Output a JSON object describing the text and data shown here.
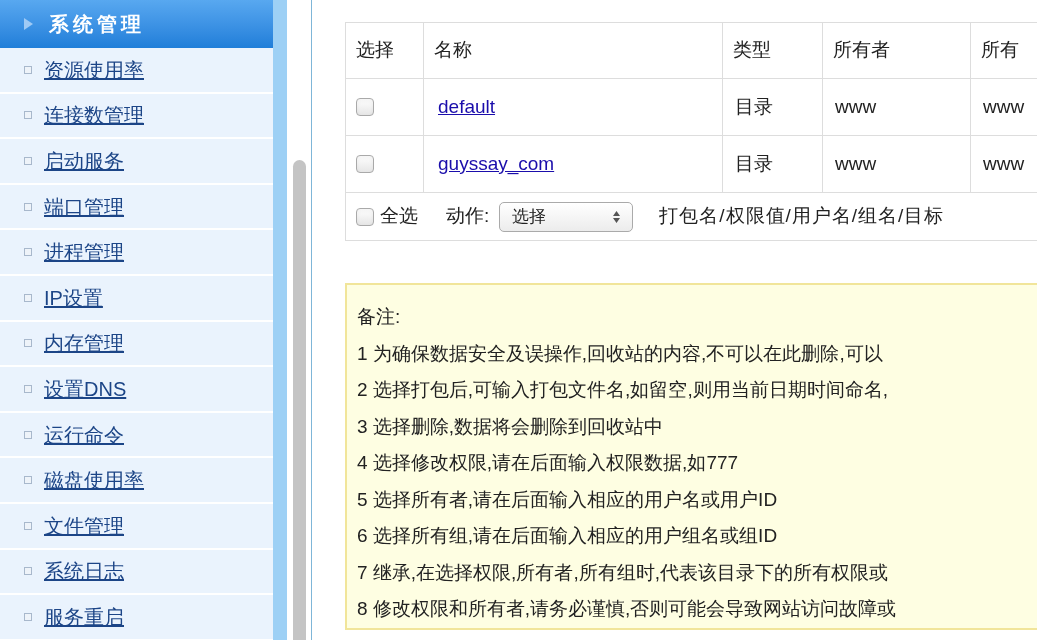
{
  "sidebar": {
    "section_title": "系统管理",
    "items": [
      {
        "label": "资源使用率"
      },
      {
        "label": "连接数管理"
      },
      {
        "label": "启动服务"
      },
      {
        "label": "端口管理"
      },
      {
        "label": "进程管理"
      },
      {
        "label": "IP设置"
      },
      {
        "label": "内存管理"
      },
      {
        "label": "设置DNS"
      },
      {
        "label": "运行命令"
      },
      {
        "label": "磁盘使用率"
      },
      {
        "label": "文件管理"
      },
      {
        "label": "系统日志"
      },
      {
        "label": "服务重启"
      }
    ]
  },
  "table": {
    "columns": [
      "选择",
      "名称",
      "类型",
      "所有者",
      "所有"
    ],
    "rows": [
      {
        "checked": false,
        "name": "default",
        "type": "目录",
        "owner": "www",
        "group": "www"
      },
      {
        "checked": false,
        "name": "guyssay_com",
        "type": "目录",
        "owner": "www",
        "group": "www"
      }
    ],
    "footer": {
      "select_all": {
        "label": "全选",
        "checked": false
      },
      "action_label": "动作:",
      "action_value": "选择",
      "hint": "打包名/权限值/用户名/组名/目标"
    }
  },
  "notes": {
    "title": "备注:",
    "lines": [
      "1 为确保数据安全及误操作,回收站的内容,不可以在此删除,可以",
      "2 选择打包后,可输入打包文件名,如留空,则用当前日期时间命名,",
      "3 选择删除,数据将会删除到回收站中",
      "4 选择修改权限,请在后面输入权限数据,如777",
      "5 选择所有者,请在后面输入相应的用户名或用户ID",
      "6 选择所有组,请在后面输入相应的用户组名或组ID",
      "7 继承,在选择权限,所有者,所有组时,代表该目录下的所有权限或",
      "8 修改权限和所有者,请务必谨慎,否则可能会导致网站访问故障或"
    ]
  }
}
